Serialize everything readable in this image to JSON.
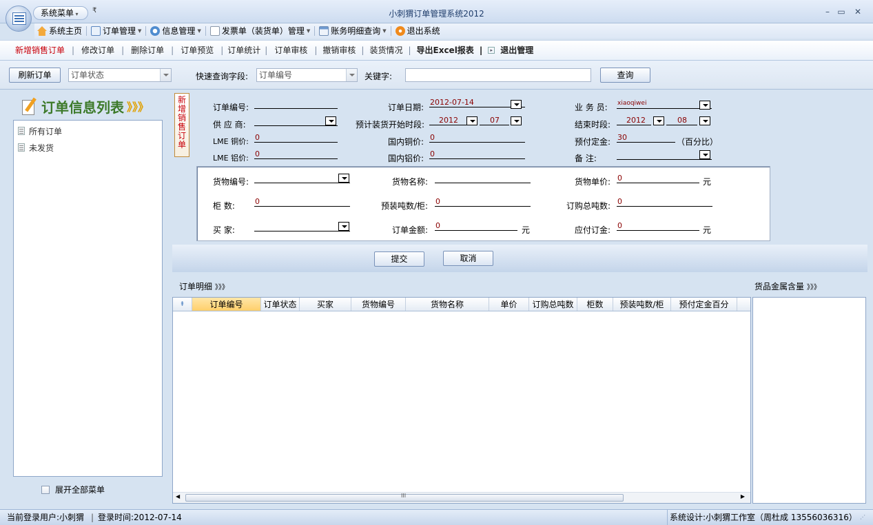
{
  "app": {
    "title": "小刺猬订单管理系统2012",
    "system_menu": "系统菜单"
  },
  "menu": [
    {
      "label": "系统主页",
      "icon": "home-icon",
      "dropdown": false
    },
    {
      "label": "订单管理",
      "icon": "order-icon",
      "dropdown": true
    },
    {
      "label": "信息管理",
      "icon": "gear-icon",
      "dropdown": true
    },
    {
      "label": "发票单（装货单）管理",
      "icon": "document-icon",
      "dropdown": true
    },
    {
      "label": "账务明细查询",
      "icon": "calculator-icon",
      "dropdown": true
    },
    {
      "label": "退出系统",
      "icon": "exit-icon",
      "dropdown": false
    }
  ],
  "toolbar": {
    "new_order": "新增销售订单",
    "edit_order": "修改订单",
    "delete_order": "删除订单",
    "preview": "订单预览",
    "stats": "订单统计",
    "review": "订单审核",
    "cancel_review": "撤销审核",
    "shipping": "装货情况",
    "export": "导出Excel报表",
    "exit_manage": "退出管理"
  },
  "filter": {
    "refresh": "刷新订单",
    "status_placeholder": "订单状态",
    "quick_field_label": "快速查询字段:",
    "quick_field_value": "订单编号",
    "keyword_label": "关键字:",
    "keyword_value": "",
    "search": "查询"
  },
  "left": {
    "header": "订单信息列表",
    "header_chevrons": "》》》",
    "items": [
      "所有订单",
      "未发货"
    ],
    "expand_all": "展开全部菜单"
  },
  "form": {
    "tab": "新增销售订单",
    "order_no_label": "订单编号:",
    "order_no": "",
    "order_date_label": "订单日期:",
    "order_date": "2012-07-14",
    "salesman_label": "业 务 员:",
    "salesman": "xiaoqiwei",
    "supplier_label": "供 应 商:",
    "supplier": "",
    "load_start_label": "预计装货开始时段:",
    "load_start_year": "2012",
    "load_start_month": "07",
    "end_label": "结束时段:",
    "end_year": "2012",
    "end_month": "08",
    "lme_cu_label": "LME 铜价:",
    "lme_cu": "0",
    "cn_cu_label": "国内铜价:",
    "cn_cu": "0",
    "deposit_label": "预付定金:",
    "deposit": "30",
    "deposit_unit": "（百分比）",
    "lme_al_label": "LME 铝价:",
    "lme_al": "0",
    "cn_al_label": "国内铝价:",
    "cn_al": "0",
    "remark_label": "备     注:",
    "remark": "",
    "goods_no_label": "货物编号:",
    "goods_no": "",
    "goods_name_label": "货物名称:",
    "goods_name": "",
    "unit_price_label": "货物单价:",
    "unit_price": "0",
    "yuan": "元",
    "cabinets_label": "柜      数:",
    "cabinets": "0",
    "tons_per_cab_label": "预装吨数/柜:",
    "tons_per_cab": "0",
    "total_tons_label": "订购总吨数:",
    "total_tons": "0",
    "buyer_label": "买      家:",
    "buyer": "",
    "amount_label": "订单金额:",
    "amount": "0",
    "payable_label": "应付订金:",
    "payable": "0",
    "submit": "提交",
    "cancel": "取消"
  },
  "detail": {
    "title": "订单明细",
    "chevrons": "》》》",
    "columns": [
      "订单编号",
      "订单状态",
      "买家",
      "货物编号",
      "货物名称",
      "单价",
      "订购总吨数",
      "柜数",
      "预装吨数/柜",
      "预付定金百分"
    ],
    "scroll_mark": "III"
  },
  "metal": {
    "title": "货品金属含量",
    "chevrons": "》》》"
  },
  "status": {
    "user": "当前登录用户:小刺猬",
    "login_time": "登录时间:2012-07-14",
    "credit": "系统设计:小刺猬工作室（周杜成 13556036316）"
  },
  "colors": {
    "accent_red": "#c8000a",
    "value_red": "#8a0000",
    "panel": "#d6e3f1"
  }
}
